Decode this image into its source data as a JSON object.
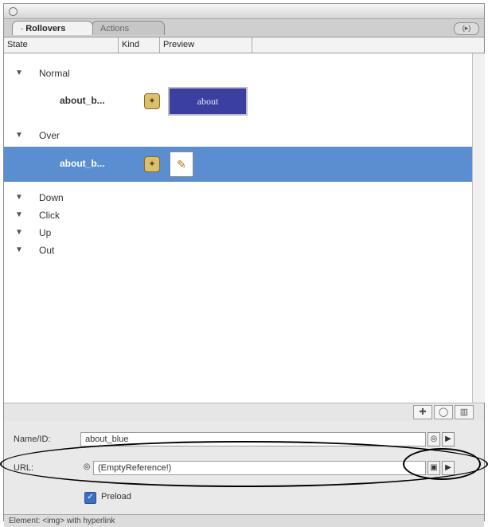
{
  "tabs": [
    {
      "label": "Rollovers",
      "marker": "◦"
    },
    {
      "label": "Actions"
    }
  ],
  "menu_button": "(▸)",
  "columns": [
    "State",
    "Kind",
    "Preview"
  ],
  "states": {
    "normal": {
      "label": "Normal",
      "item_name": "about_b...",
      "preview_text": "about"
    },
    "over": {
      "label": "Over",
      "item_name": "about_b..."
    },
    "down": {
      "label": "Down"
    },
    "click": {
      "label": "Click"
    },
    "up": {
      "label": "Up"
    },
    "out": {
      "label": "Out"
    }
  },
  "tools": [
    "new-state-icon",
    "speech-bubble-icon",
    "trash-icon"
  ],
  "fields": {
    "name_label": "Name/ID:",
    "name_value": "about_blue",
    "url_label": "URL:",
    "url_value": "(EmptyReference!)",
    "preload_label": "Preload",
    "preload_checked": true
  },
  "status": "Element: <img> with hyperlink",
  "colors": {
    "selection": "#5a8ed0",
    "preview_blue": "#3a3fa0",
    "checkbox": "#3b6fc2"
  }
}
